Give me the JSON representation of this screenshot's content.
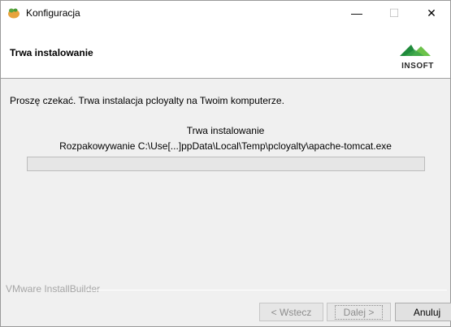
{
  "window": {
    "title": "Konfiguracja",
    "controls": {
      "minimize": "—",
      "maximize": "☐",
      "close": "✕"
    }
  },
  "header": {
    "title": "Trwa instalowanie",
    "logo_text": "INSOFT"
  },
  "main": {
    "message": "Proszę czekać. Trwa instalacja pcloyalty na Twoim komputerze.",
    "status_title": "Trwa instalowanie",
    "status_detail": "Rozpakowywanie C:\\Use[...]ppData\\Local\\Temp\\pcloyalty\\apache-tomcat.exe",
    "progress_percent": 0
  },
  "footer": {
    "brand": "VMware InstallBuilder",
    "buttons": {
      "back": "< Wstecz",
      "next": "Dalej >",
      "cancel": "Anuluj"
    }
  },
  "colors": {
    "logo_green_dark": "#1f8a3b",
    "logo_green_light": "#6cc24a",
    "progress_fill": "#06b025"
  }
}
